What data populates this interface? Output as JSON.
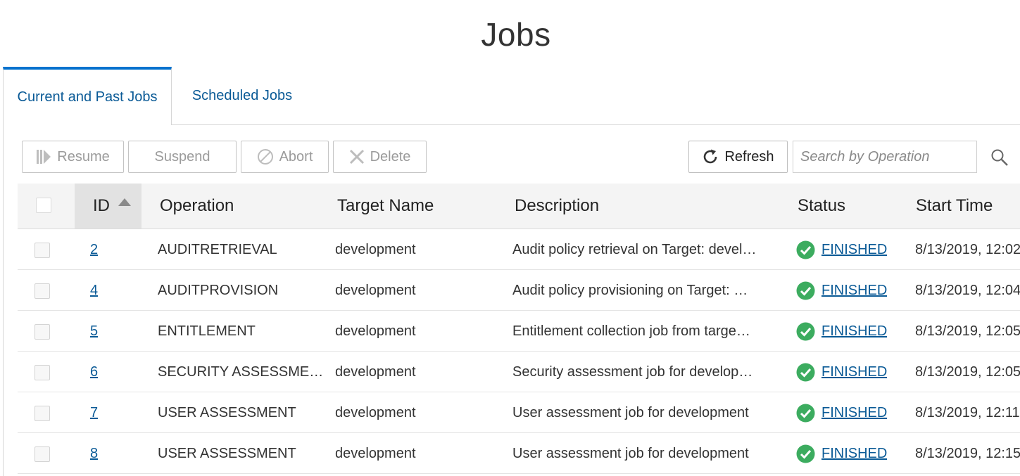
{
  "page": {
    "title": "Jobs"
  },
  "tabs": [
    {
      "label": "Current and Past Jobs",
      "active": true
    },
    {
      "label": "Scheduled Jobs",
      "active": false
    }
  ],
  "toolbar": {
    "resume": "Resume",
    "suspend": "Suspend",
    "abort": "Abort",
    "delete": "Delete",
    "refresh": "Refresh",
    "search_placeholder": "Search by Operation",
    "search_value": ""
  },
  "table": {
    "columns": [
      "ID",
      "Operation",
      "Target Name",
      "Description",
      "Status",
      "Start Time"
    ],
    "sort": {
      "column": "ID",
      "direction": "ascending"
    },
    "rows": [
      {
        "id": "2",
        "operation": "AUDITRETRIEVAL",
        "target": "development",
        "description": "Audit policy retrieval on Target: devel…",
        "status": "FINISHED",
        "start_time": "8/13/2019, 12:02"
      },
      {
        "id": "4",
        "operation": "AUDITPROVISION",
        "target": "development",
        "description": "Audit policy provisioning on Target: …",
        "status": "FINISHED",
        "start_time": "8/13/2019, 12:04"
      },
      {
        "id": "5",
        "operation": "ENTITLEMENT",
        "target": "development",
        "description": "Entitlement collection job from targe…",
        "status": "FINISHED",
        "start_time": "8/13/2019, 12:05"
      },
      {
        "id": "6",
        "operation": "SECURITY ASSESSME…",
        "target": "development",
        "description": "Security assessment job for develop…",
        "status": "FINISHED",
        "start_time": "8/13/2019, 12:05"
      },
      {
        "id": "7",
        "operation": "USER ASSESSMENT",
        "target": "development",
        "description": "User assessment job for development",
        "status": "FINISHED",
        "start_time": "8/13/2019, 12:11"
      },
      {
        "id": "8",
        "operation": "USER ASSESSMENT",
        "target": "development",
        "description": "User assessment job for development",
        "status": "FINISHED",
        "start_time": "8/13/2019, 12:15"
      }
    ]
  },
  "colors": {
    "link": "#0a5a96",
    "accent": "#0572ce",
    "success": "#3cac5f"
  }
}
